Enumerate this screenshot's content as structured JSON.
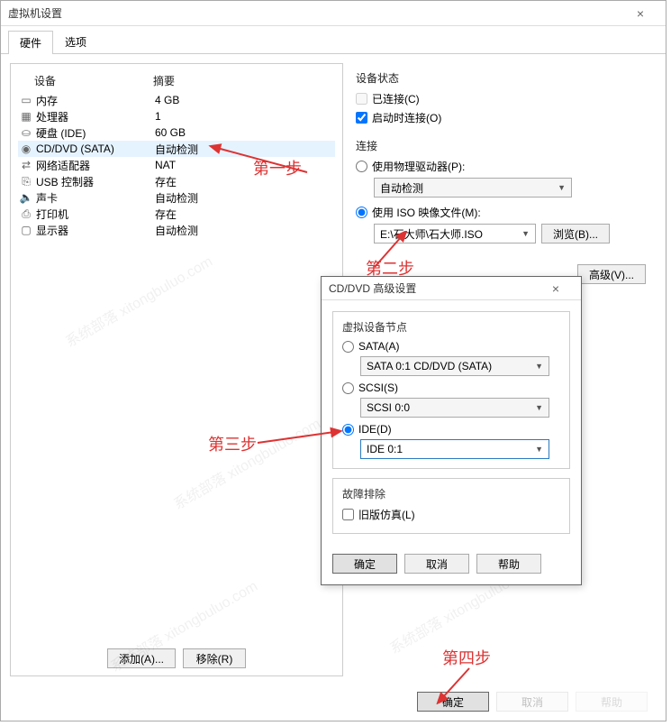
{
  "window": {
    "title": "虚拟机设置"
  },
  "tabs": {
    "hardware": "硬件",
    "options": "选项"
  },
  "columns": {
    "device": "设备",
    "summary": "摘要"
  },
  "devices": [
    {
      "name": "内存",
      "summary": "4 GB",
      "icon": "memory"
    },
    {
      "name": "处理器",
      "summary": "1",
      "icon": "cpu"
    },
    {
      "name": "硬盘 (IDE)",
      "summary": "60 GB",
      "icon": "disk"
    },
    {
      "name": "CD/DVD (SATA)",
      "summary": "自动检测",
      "icon": "cd",
      "selected": true
    },
    {
      "name": "网络适配器",
      "summary": "NAT",
      "icon": "net"
    },
    {
      "name": "USB 控制器",
      "summary": "存在",
      "icon": "usb"
    },
    {
      "name": "声卡",
      "summary": "自动检测",
      "icon": "sound"
    },
    {
      "name": "打印机",
      "summary": "存在",
      "icon": "printer"
    },
    {
      "name": "显示器",
      "summary": "自动检测",
      "icon": "display"
    }
  ],
  "left_buttons": {
    "add": "添加(A)...",
    "remove": "移除(R)"
  },
  "status": {
    "title": "设备状态",
    "connected": "已连接(C)",
    "connect_on_power": "启动时连接(O)"
  },
  "connection": {
    "title": "连接",
    "use_physical": "使用物理驱动器(P):",
    "physical_value": "自动检测",
    "use_iso": "使用 ISO 映像文件(M):",
    "iso_value": "E:\\石大师\\石大师.ISO",
    "browse": "浏览(B)..."
  },
  "advanced_btn": "高级(V)...",
  "modal": {
    "title": "CD/DVD 高级设置",
    "node_title": "虚拟设备节点",
    "sata": "SATA(A)",
    "sata_value": "SATA 0:1   CD/DVD (SATA)",
    "scsi": "SCSI(S)",
    "scsi_value": "SCSI 0:0",
    "ide": "IDE(D)",
    "ide_value": "IDE 0:1",
    "troubleshoot_title": "故障排除",
    "legacy": "旧版仿真(L)",
    "ok": "确定",
    "cancel": "取消",
    "help": "帮助"
  },
  "footer": {
    "ok": "确定",
    "cancel": "取消",
    "help": "帮助"
  },
  "steps": {
    "s1": "第一步",
    "s2": "第二步",
    "s3": "第三步",
    "s4": "第四步"
  },
  "watermark_text": "系统部落 xitongbuluo.com"
}
